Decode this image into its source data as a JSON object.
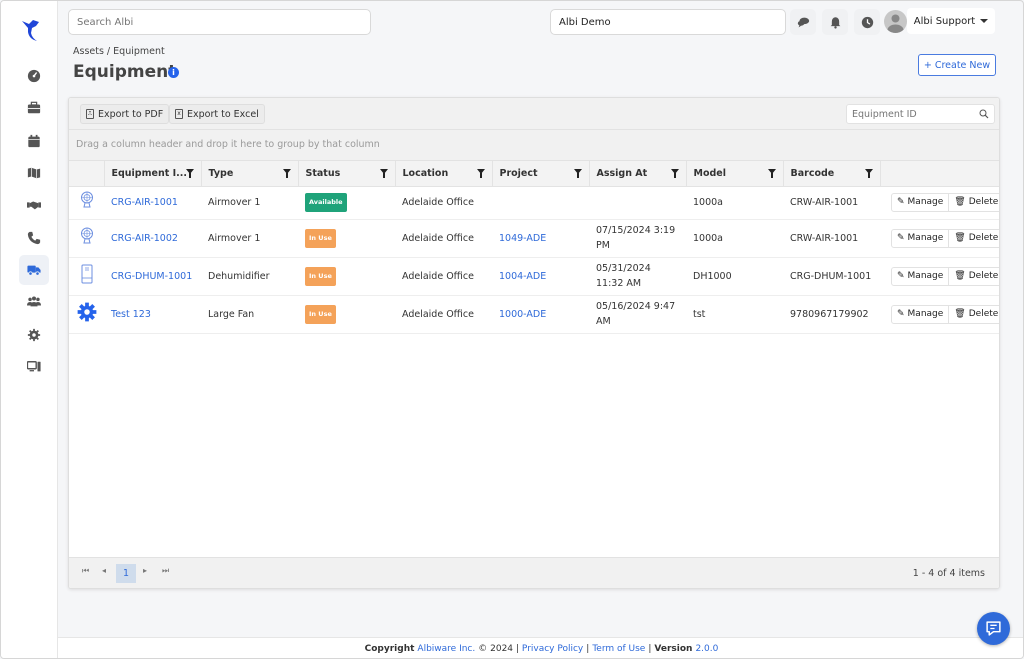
{
  "header": {
    "search_placeholder": "Search Albi",
    "company_value": "Albi Demo",
    "user_name": "Albi Support",
    "icons": [
      "chat-bubbles-icon",
      "bell-icon",
      "clock-icon",
      "avatar"
    ]
  },
  "sidebar": {
    "items": [
      {
        "name": "dashboard",
        "icon": "dashboard-gauge-icon"
      },
      {
        "name": "jobs",
        "icon": "briefcase-icon"
      },
      {
        "name": "calendar",
        "icon": "calendar-icon"
      },
      {
        "name": "map",
        "icon": "map-icon"
      },
      {
        "name": "clients",
        "icon": "handshake-icon"
      },
      {
        "name": "calls",
        "icon": "phone-icon"
      },
      {
        "name": "equipment",
        "icon": "truck-icon",
        "active": true
      },
      {
        "name": "users",
        "icon": "users-icon"
      },
      {
        "name": "settings",
        "icon": "gear-icon"
      },
      {
        "name": "devices",
        "icon": "desktop-icon"
      }
    ]
  },
  "page": {
    "breadcrumb": "Assets / Equipment",
    "title": "Equipment",
    "create_label": "+ Create New"
  },
  "grid": {
    "export_pdf": "Export to PDF",
    "export_excel": "Export to Excel",
    "id_search_placeholder": "Equipment ID",
    "group_hint": "Drag a column header and drop it here to group by that column",
    "columns": [
      "Equipment I...",
      "Type",
      "Status",
      "Location",
      "Project",
      "Assign At",
      "Model",
      "Barcode"
    ],
    "rows": [
      {
        "icon": "fan-icon",
        "id": "CRG-AIR-1001",
        "type": "Airmover 1",
        "status": "Available",
        "location": "Adelaide Office",
        "project": "",
        "assign_at": "",
        "model": "1000a",
        "barcode": "CRW-AIR-1001"
      },
      {
        "icon": "fan-icon",
        "id": "CRG-AIR-1002",
        "type": "Airmover 1",
        "status": "In Use",
        "location": "Adelaide Office",
        "project": "1049-ADE",
        "assign_at": "07/15/2024 3:19 PM",
        "model": "1000a",
        "barcode": "CRW-AIR-1001"
      },
      {
        "icon": "dehumidifier-icon",
        "id": "CRG-DHUM-1001",
        "type": "Dehumidifier",
        "status": "In Use",
        "location": "Adelaide Office",
        "project": "1004-ADE",
        "assign_at": "05/31/2024 11:32 AM",
        "model": "DH1000",
        "barcode": "CRG-DHUM-1001"
      },
      {
        "icon": "gear-icon",
        "id": "Test 123",
        "type": "Large Fan",
        "status": "In Use",
        "location": "Adelaide Office",
        "project": "1000-ADE",
        "assign_at": "05/16/2024 9:47 AM",
        "model": "tst",
        "barcode": "9780967179902"
      }
    ],
    "manage_label": "Manage",
    "delete_label": "Delete",
    "pager": {
      "current_page": "1",
      "info": "1 - 4 of 4 items"
    }
  },
  "footer": {
    "copyright": "Copyright",
    "company": "Albiware Inc.",
    "year": "© 2024 |",
    "privacy": "Privacy Policy",
    "sep": "|",
    "terms": "Term of Use",
    "sep2": "|",
    "version_label": "Version",
    "version": "2.0.0"
  },
  "colors": {
    "accent": "#2f6ad9",
    "available": "#1fa37a",
    "in_use": "#f4a259"
  }
}
